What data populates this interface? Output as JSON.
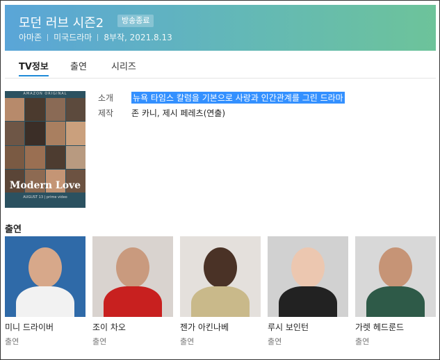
{
  "header": {
    "title": "모던 러브 시즌2",
    "status": "방송종료",
    "meta": [
      "아마존",
      "미국드라마",
      "8부작, 2021.8.13"
    ],
    "gradient": [
      "#5aa5d8",
      "#6dc39a"
    ]
  },
  "tabs": [
    {
      "label": "TV정보"
    },
    {
      "label": "출연"
    },
    {
      "label": "시리즈"
    }
  ],
  "poster": {
    "top_text": "AMAZON ORIGINAL",
    "title": "Modern Love",
    "sub": "AUGUST 13 | prime video"
  },
  "info": [
    {
      "label": "소개",
      "value": "뉴욕 타임스 칼럼을 기본으로 사랑과 인간관계를 그린 드라마"
    },
    {
      "label": "제작",
      "value": "존 카니, 제시 페레츠(연출)"
    }
  ],
  "cast_heading": "출연",
  "cast": [
    {
      "name": "미니 드라이버",
      "role": "출연",
      "bg": "#2f6aa8",
      "shirt": "#f2f2f2"
    },
    {
      "name": "조이 차오",
      "role": "출연",
      "bg": "#d9d3cf",
      "shirt": "#c8201f"
    },
    {
      "name": "젠가 아킨나베",
      "role": "출연",
      "bg": "#e4e0dc",
      "shirt": "#c9b98a"
    },
    {
      "name": "루시 보인턴",
      "role": "출연",
      "bg": "#d1d1d1",
      "shirt": "#222"
    },
    {
      "name": "가렛 헤드룬드",
      "role": "출연",
      "bg": "#d8d8d8",
      "shirt": "#2e5a48"
    }
  ]
}
